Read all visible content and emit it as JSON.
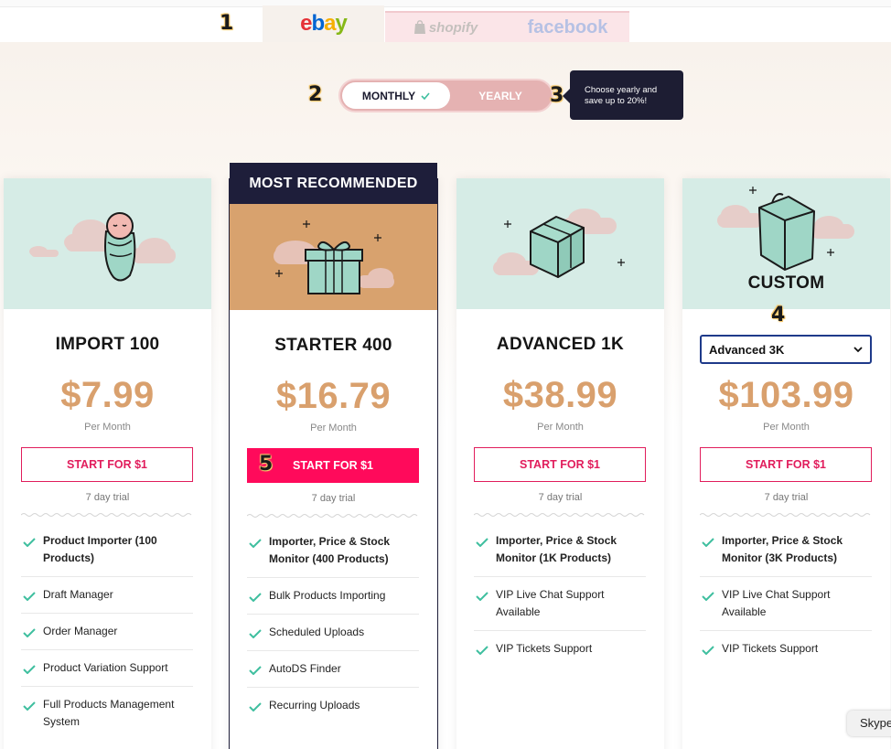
{
  "annotations": [
    "1",
    "2",
    "3",
    "4",
    "5"
  ],
  "platform_tabs": [
    {
      "label": "ebay",
      "active": true
    },
    {
      "label": "shopify",
      "active": false
    },
    {
      "label": "facebook",
      "active": false
    }
  ],
  "billing_toggle": {
    "monthly_label": "MONTHLY",
    "yearly_label": "YEARLY",
    "selected": "MONTHLY",
    "tooltip": "Choose yearly and save up to 20%!"
  },
  "recommended_banner": "MOST RECOMMENDED",
  "plans": [
    {
      "name": "IMPORT 100",
      "price": "$7.99",
      "period": "Per Month",
      "cta": "START FOR $1",
      "trial": "7 day trial",
      "features": [
        "Product Importer (100 Products)",
        "Draft Manager",
        "Order Manager",
        "Product Variation Support",
        "Full Products Management System"
      ]
    },
    {
      "name": "STARTER 400",
      "price": "$16.79",
      "period": "Per Month",
      "cta": "START FOR $1",
      "trial": "7 day trial",
      "features": [
        "Importer, Price & Stock Monitor (400 Products)",
        "Bulk Products Importing",
        "Scheduled Uploads",
        "AutoDS Finder",
        "Recurring Uploads"
      ]
    },
    {
      "name": "ADVANCED 1K",
      "price": "$38.99",
      "period": "Per Month",
      "cta": "START FOR $1",
      "trial": "7 day trial",
      "features": [
        "Importer, Price & Stock Monitor (1K Products)",
        "VIP Live Chat Support Available",
        "VIP Tickets Support"
      ]
    },
    {
      "name": "CUSTOM",
      "selected_option": "Advanced 3K",
      "price": "$103.99",
      "period": "Per Month",
      "cta": "START FOR $1",
      "trial": "7 day trial",
      "features": [
        "Importer, Price & Stock Monitor (3K Products)",
        "VIP Live Chat Support Available",
        "VIP Tickets Support"
      ]
    }
  ],
  "chat_widget": "Skype",
  "colors": {
    "accent": "#ff0a5b",
    "price": "#d9a06d",
    "header_mint": "#d6ece6",
    "header_orange": "#d8a26e",
    "check": "#3fbf9f",
    "dark": "#1e1e3a"
  }
}
